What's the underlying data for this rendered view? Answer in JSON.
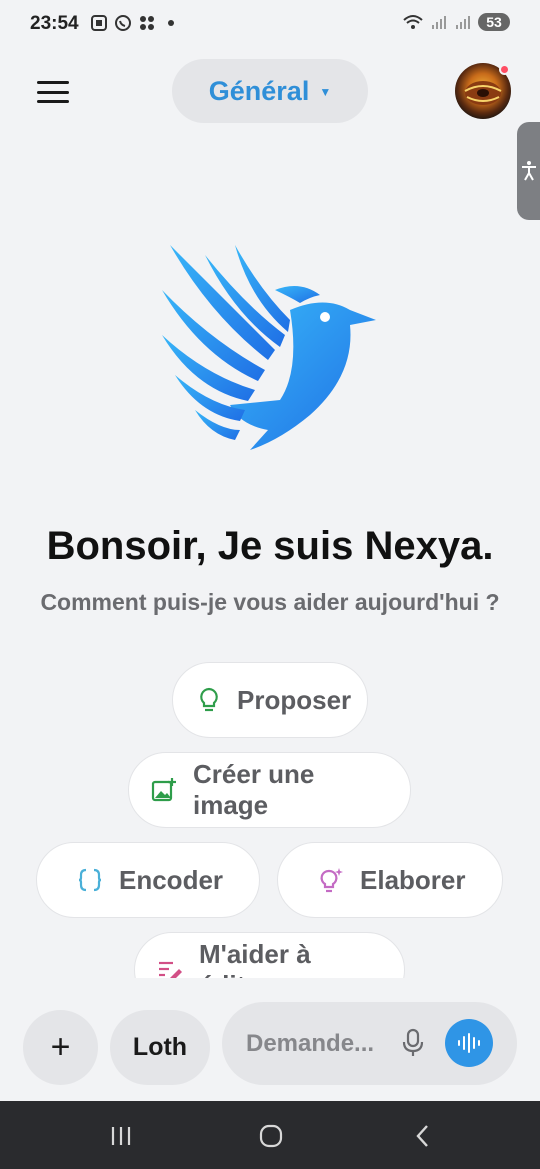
{
  "status_bar": {
    "time": "23:54",
    "battery": "53",
    "icons_left": [
      "screenshot-icon",
      "whatsapp-icon",
      "apps-icon",
      "dot-icon"
    ],
    "icons_right": [
      "wifi-icon",
      "signal-icon",
      "signal-icon",
      "battery-icon"
    ]
  },
  "header": {
    "menu_icon": "hamburger-icon",
    "mode_label": "Général",
    "mode_chevron": "chevron-down-icon",
    "avatar_badge_color": "#ff4d63"
  },
  "main": {
    "greeting": "Bonsoir, Je suis Nexya.",
    "subtitle": "Comment puis-je vous aider aujourd'hui ?",
    "suggestions": [
      {
        "label": "Proposer",
        "icon": "lightbulb-icon",
        "color": "#2e9d4a"
      },
      {
        "label": "Créer une image",
        "icon": "image-add-icon",
        "color": "#2e9d4a"
      },
      {
        "label": "Encoder",
        "icon": "code-braces-icon",
        "color": "#4ab0d8"
      },
      {
        "label": "Elaborer",
        "icon": "lightbulb-sparkle-icon",
        "color": "#c46bc4"
      },
      {
        "label": "M'aider à éditer",
        "icon": "edit-pen-icon",
        "color": "#d24f86"
      }
    ]
  },
  "composer": {
    "plus_label": "+",
    "model_label": "Loth",
    "input_placeholder": "Demande...",
    "mic_icon": "microphone-icon",
    "voice_icon": "voice-wave-icon",
    "accent": "#2f95e6"
  },
  "nav_bar": {
    "recent": "recents-icon",
    "home": "home-icon",
    "back": "back-icon"
  },
  "colors": {
    "brand": "#2f8fd8",
    "background": "#f2f3f5"
  }
}
